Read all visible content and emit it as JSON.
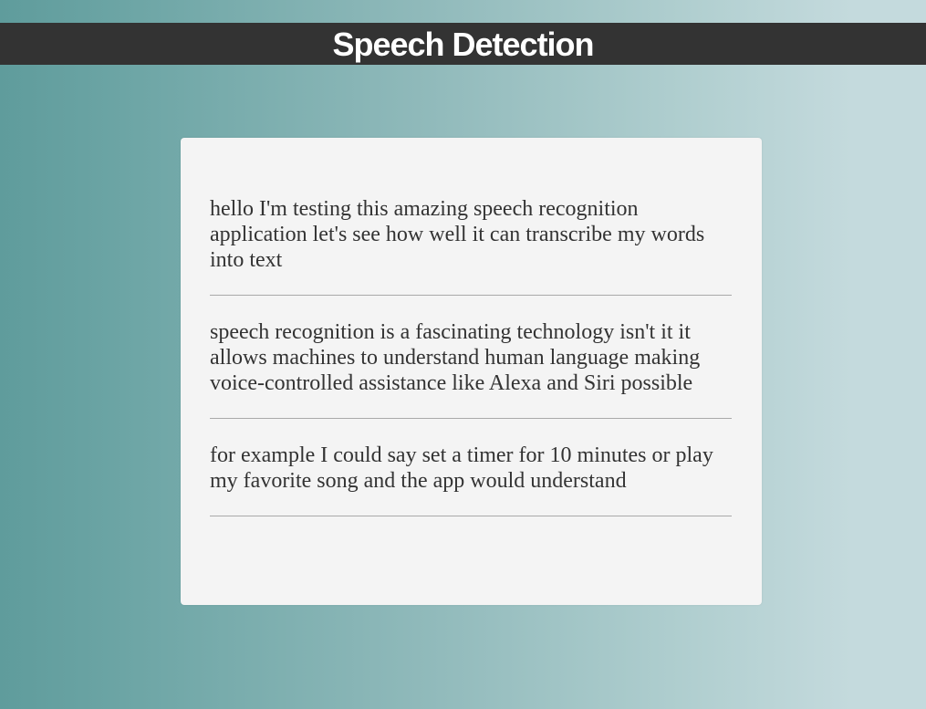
{
  "header": {
    "title": "Speech Detection"
  },
  "transcripts": [
    "hello I'm testing this amazing speech recognition application let's see how well it can transcribe my words into text",
    "speech recognition is a fascinating technology isn't it it allows machines to understand human language making voice-controlled assistance like Alexa and Siri possible",
    "for example I could say set a timer for 10 minutes or play my favorite song and the app would understand"
  ],
  "colors": {
    "header_bg": "#333333",
    "panel_bg": "#f4f4f4",
    "text": "#333333",
    "gradient_start": "#5f9c9c",
    "gradient_end": "#c4dadd"
  }
}
